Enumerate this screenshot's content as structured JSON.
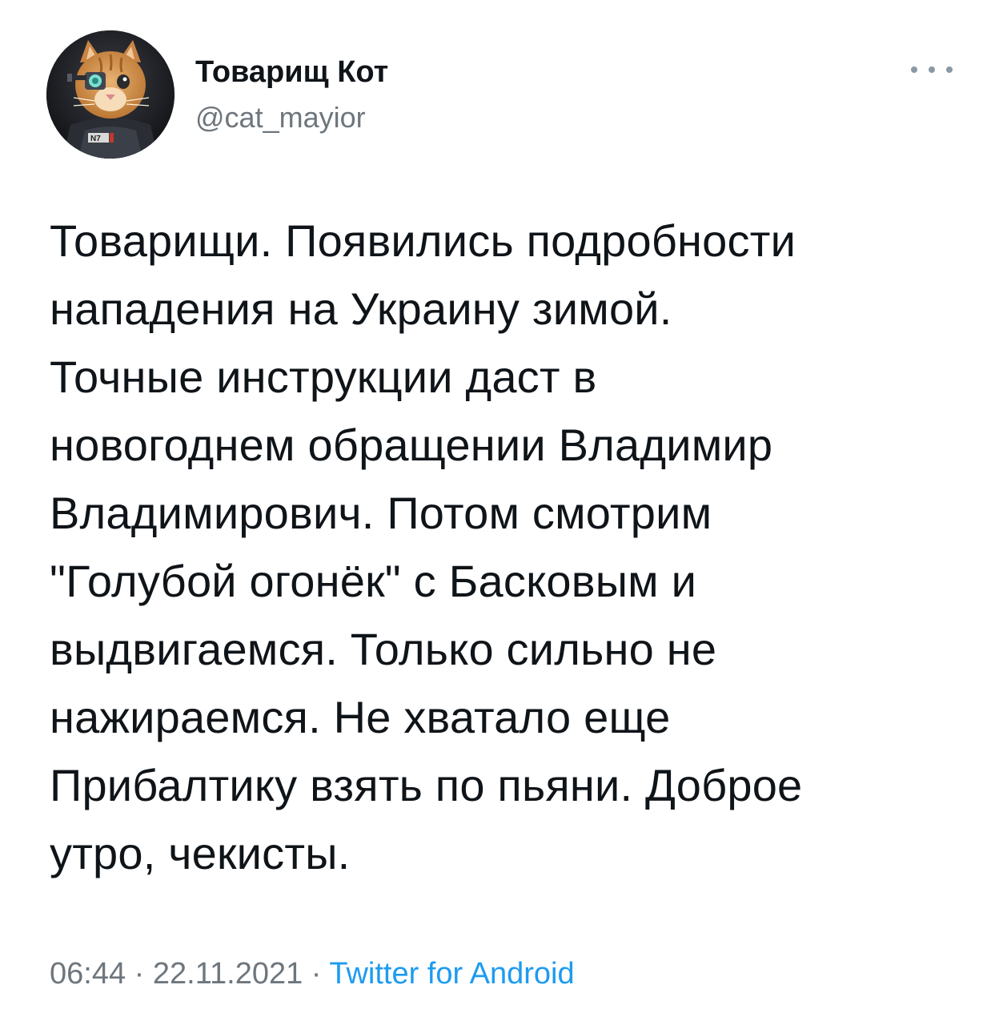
{
  "author": {
    "display_name": "Товарищ Кот",
    "handle": "@cat_mayior",
    "avatar_badge": "N7"
  },
  "tweet": {
    "lines": [
      "Товарищи. Появились подробности",
      "нападения на Украину зимой.",
      "Точные инструкции даст в",
      "новогоднем обращении Владимир",
      "Владимирович. Потом смотрим",
      "\"Голубой огонёк\" с Басковым и",
      "выдвигаемся. Только сильно не",
      "нажираемся. Не хватало еще",
      "Прибалтику взять по пьяни. Доброе",
      "утро, чекисты."
    ]
  },
  "meta": {
    "time": "06:44",
    "separator_1": " · ",
    "date": "22.11.2021",
    "separator_2": " · ",
    "source": "Twitter for Android"
  },
  "icons": {
    "more": "more-horizontal-icon"
  },
  "colors": {
    "text": "#0f1419",
    "secondary": "#6e767d",
    "link": "#1d9bf0",
    "background": "#ffffff"
  }
}
